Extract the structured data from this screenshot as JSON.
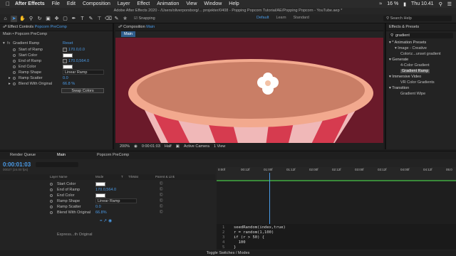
{
  "menubar": {
    "app": "After Effects",
    "items": [
      "File",
      "Edit",
      "Composition",
      "Layer",
      "Effect",
      "Animation",
      "View",
      "Window",
      "Help"
    ],
    "battery": "16 %",
    "clock": "Thu 10.41"
  },
  "window": {
    "title": "Adobe After Effects 2020 - /Users/oliverporsborg/... projekter/0408 - Popping Popcorn Tutorial/AE/Popping Popcorn - YouTube.aep *",
    "snapping": "Snapping",
    "workspaces": [
      "Default",
      "Learn",
      "Standard"
    ],
    "search_help": "Search Help"
  },
  "effect_controls": {
    "tab": "Effect Controls",
    "tab_target": "Popcorn PreComp",
    "breadcrumb": "Main • Popcorn PreComp",
    "effect_name": "Gradient Ramp",
    "reset": "Reset",
    "props": [
      {
        "label": "Start of Ramp",
        "value": "170.0,0.0"
      },
      {
        "label": "Start Color",
        "value": ""
      },
      {
        "label": "End of Ramp",
        "value": "170.0,564.0"
      },
      {
        "label": "End Color",
        "value": ""
      },
      {
        "label": "Ramp Shape",
        "value": "Linear Ramp"
      },
      {
        "label": "Ramp Scatter",
        "value": "0.0"
      },
      {
        "label": "Blend With Original",
        "value": "66.8 %"
      }
    ],
    "swap_colors": "Swap Colors"
  },
  "composition": {
    "tab": "Composition",
    "tab_target": "Main",
    "sub_tab": "Main",
    "zoom": "200%",
    "timecode": "0:00:01:03",
    "resolution": "Half",
    "camera": "Active Camera",
    "view": "1 View"
  },
  "effects_presets": {
    "title": "Effects & Presets",
    "search": "gradient",
    "items": [
      {
        "label": "* Animation Presets",
        "indent": 0,
        "highlight": false
      },
      {
        "label": "Image - Creative",
        "indent": 1,
        "highlight": false
      },
      {
        "label": "Coloriz...unset gradient",
        "indent": 2,
        "highlight": false
      },
      {
        "label": "Generate",
        "indent": 0,
        "highlight": false
      },
      {
        "label": "4-Color Gradient",
        "indent": 2,
        "highlight": false
      },
      {
        "label": "Gradient Ramp",
        "indent": 2,
        "highlight": true
      },
      {
        "label": "Immersive Video",
        "indent": 0,
        "highlight": false
      },
      {
        "label": "VR Color Gradients",
        "indent": 2,
        "highlight": false
      },
      {
        "label": "Transition",
        "indent": 0,
        "highlight": false
      },
      {
        "label": "Gradient Wipe",
        "indent": 2,
        "highlight": false
      }
    ]
  },
  "timeline": {
    "tabs": [
      "Render Queue",
      "Main",
      "Popcorn PreComp"
    ],
    "timecode": "0:00:01:03",
    "frame_info": "00027 (24.00 fps)",
    "columns": [
      "Layer Name",
      "Mode",
      "T",
      "TrkMat",
      "Parent & Link"
    ],
    "layer_props": [
      {
        "label": "Start Color",
        "value": ""
      },
      {
        "label": "End of Ramp",
        "value": "170.0,564.0"
      },
      {
        "label": "End Color",
        "value": ""
      },
      {
        "label": "Ramp Shape",
        "value": "Linear Ramp"
      },
      {
        "label": "Ramp Scatter",
        "value": "0.0"
      },
      {
        "label": "Blend With Original",
        "value": "66.8%"
      }
    ],
    "expression_label": "Express...th Original",
    "ruler_ticks": [
      "0:00f",
      "00:12f",
      "01:00f",
      "01:12f",
      "02:00f",
      "02:12f",
      "03:00f",
      "03:12f",
      "04:00f",
      "04:12f",
      "05:0"
    ],
    "code": [
      {
        "n": "1",
        "text": "seedRandom(index,true)"
      },
      {
        "n": "2",
        "text": "r = random(1,100)"
      },
      {
        "n": "3",
        "text": "if (r > 50) {"
      },
      {
        "n": "4",
        "text": "  100"
      },
      {
        "n": "5",
        "text": "}"
      }
    ],
    "footer": "Toggle Switches / Modes"
  },
  "colors": {
    "accent": "#4a9be8",
    "bg_maroon": "#6b1a2a",
    "bucket_rim": "#f2a98e",
    "bucket_inner": "#c97e66",
    "stripe_red": "#d63b4f",
    "stripe_pink": "#f0b8b8"
  }
}
